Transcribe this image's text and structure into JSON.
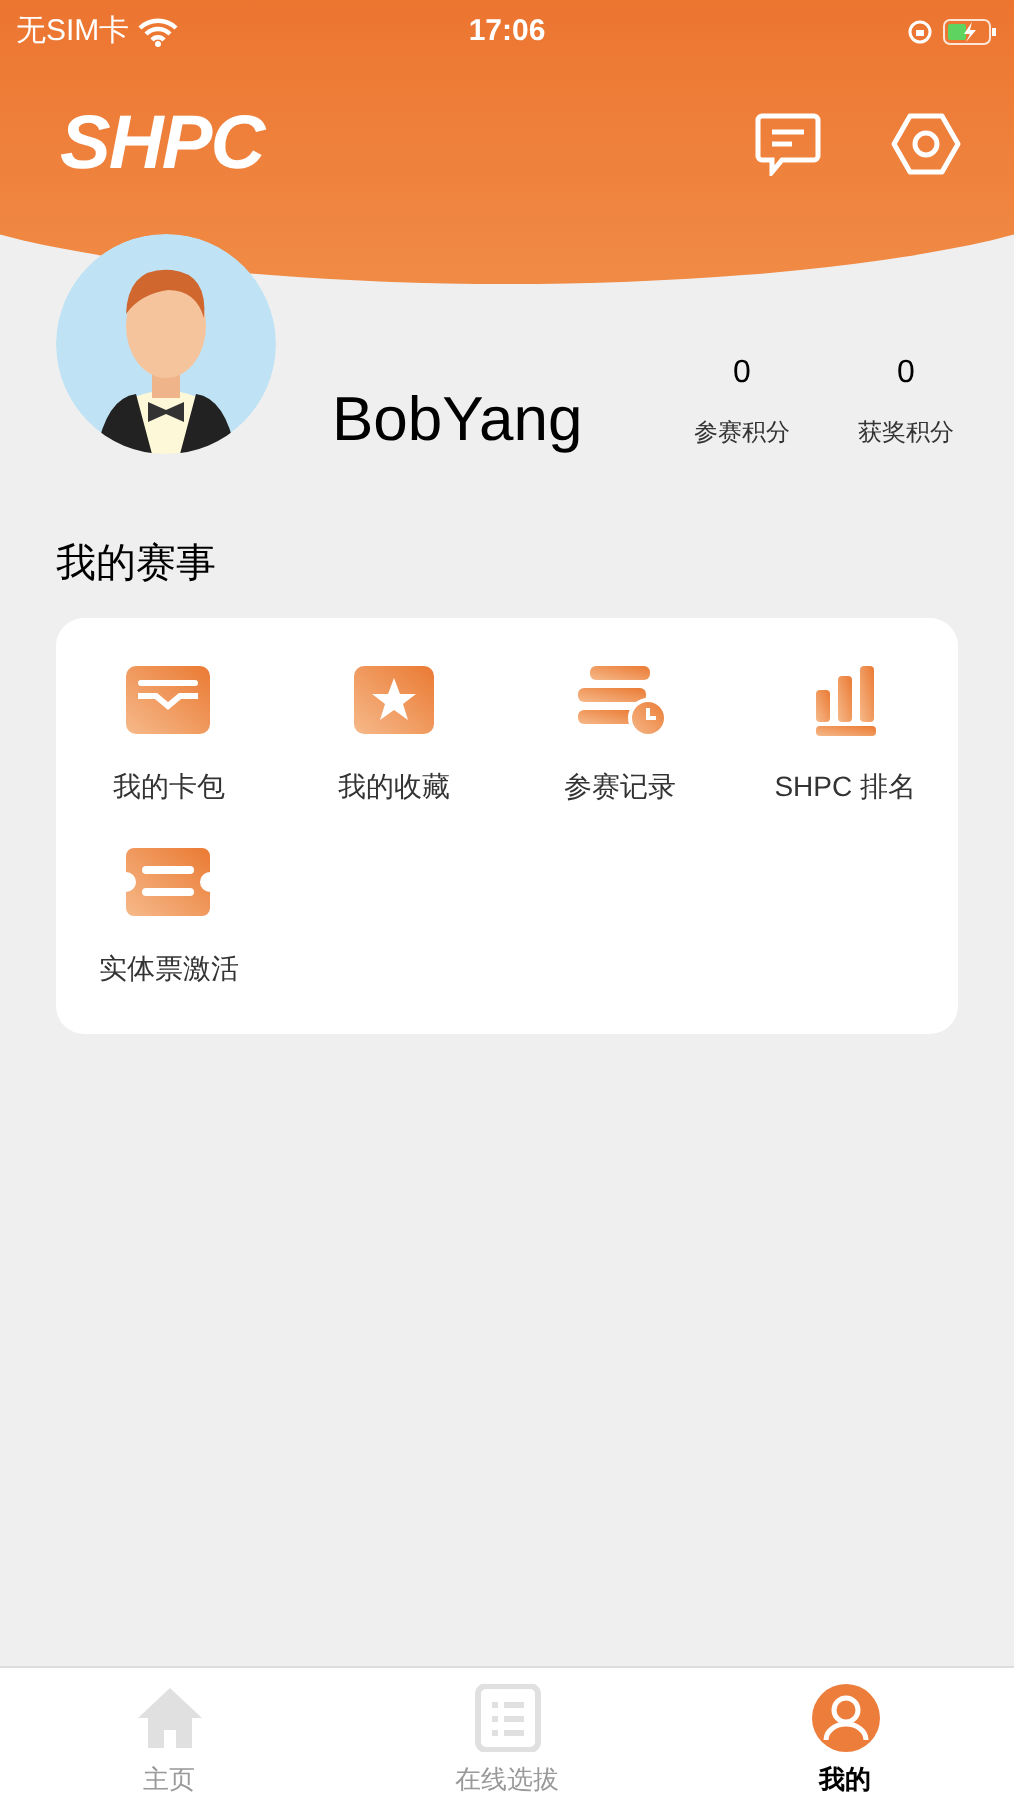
{
  "status_bar": {
    "carrier": "无SIM卡",
    "time": "17:06"
  },
  "header": {
    "logo": "SHPC"
  },
  "profile": {
    "name": "BobYang",
    "stats": [
      {
        "value": "0",
        "label": "参赛积分"
      },
      {
        "value": "0",
        "label": "获奖积分"
      }
    ]
  },
  "section": {
    "title": "我的赛事",
    "items": [
      {
        "kind": "wallet",
        "label": "我的卡包"
      },
      {
        "kind": "star",
        "label": "我的收藏"
      },
      {
        "kind": "records",
        "label": "参赛记录"
      },
      {
        "kind": "ranking",
        "label": "SHPC 排名"
      },
      {
        "kind": "ticket",
        "label": "实体票激活"
      }
    ]
  },
  "tab_bar": [
    {
      "kind": "home",
      "label": "主页",
      "selected": false
    },
    {
      "kind": "list",
      "label": "在线选拔",
      "selected": false
    },
    {
      "kind": "user",
      "label": "我的",
      "selected": true
    }
  ]
}
